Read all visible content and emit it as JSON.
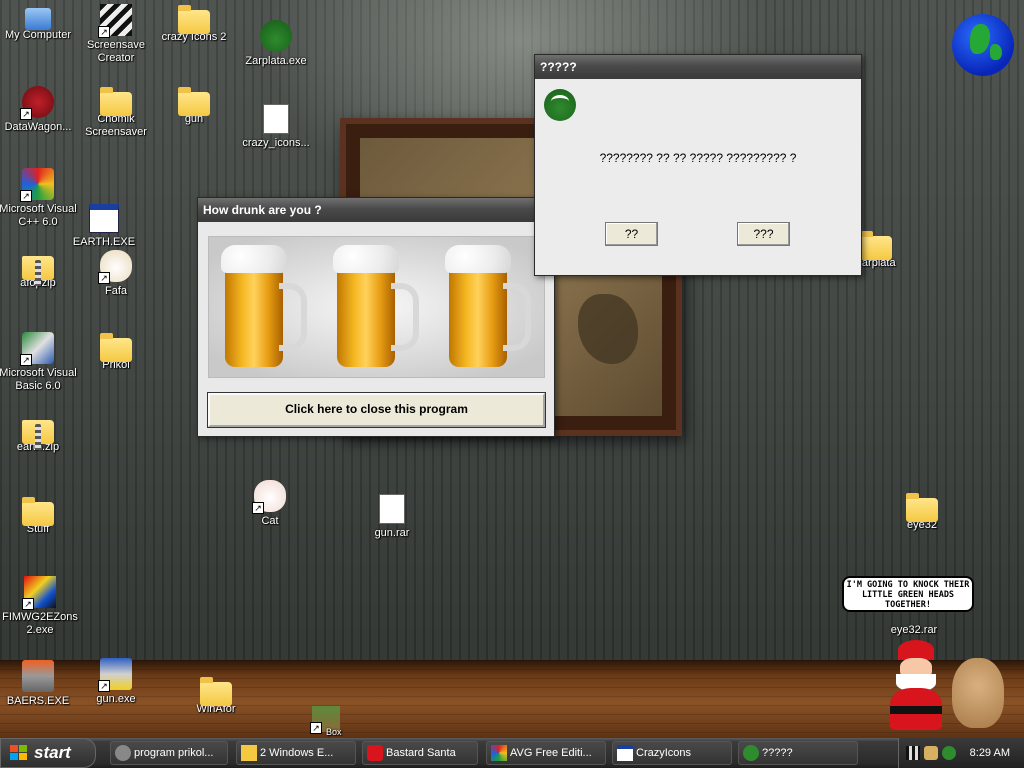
{
  "desktop": {
    "icons": [
      {
        "id": "my-computer",
        "label": "My Computer"
      },
      {
        "id": "screensaver-creator",
        "label": "Screensave\nCreator"
      },
      {
        "id": "crazy-icons-2",
        "label": "crazy Icons 2"
      },
      {
        "id": "zarplata-exe",
        "label": "Zarplata.exe"
      },
      {
        "id": "datawagon",
        "label": "DataWagon..."
      },
      {
        "id": "chomik-screensaver",
        "label": "Chomik\nScreensaver"
      },
      {
        "id": "gun-folder",
        "label": "gun"
      },
      {
        "id": "crazy-icons-file",
        "label": "crazy_icons..."
      },
      {
        "id": "ms-visual-cpp",
        "label": "Microsoft Visual\nC++ 6.0"
      },
      {
        "id": "earth-exe",
        "label": "EARTH.EXE"
      },
      {
        "id": "afopzip",
        "label": "afopzip"
      },
      {
        "id": "fafa",
        "label": "Fafa"
      },
      {
        "id": "ms-visual-basic",
        "label": "Microsoft Visual\nBasic 6.0"
      },
      {
        "id": "prikol",
        "label": "Prikol"
      },
      {
        "id": "earth-zip",
        "label": "earth.zip"
      },
      {
        "id": "cat",
        "label": "Cat"
      },
      {
        "id": "gun-rar",
        "label": "gun.rar"
      },
      {
        "id": "stuff",
        "label": "Stuff"
      },
      {
        "id": "crazy-icons-exe",
        "label": "FIMWG2EZons\n2.exe"
      },
      {
        "id": "zarplata-folder",
        "label": "zarplata"
      },
      {
        "id": "eye32",
        "label": "eye32"
      },
      {
        "id": "eye32-rar",
        "label": "eye32.rar"
      },
      {
        "id": "baers-exe",
        "label": "BAERS.EXE"
      },
      {
        "id": "gun-exe",
        "label": "gun.exe"
      },
      {
        "id": "winafor",
        "label": "WinAfor"
      },
      {
        "id": "box",
        "label": "Box"
      }
    ]
  },
  "drunk_window": {
    "title": "How drunk are you ?",
    "close_label": "Click here to close this program"
  },
  "dialog": {
    "title": "?????",
    "message": "???????? ?? ?? ????? ????????? ?",
    "button_yes": "??",
    "button_no": "???"
  },
  "speech_bubble": "I'M GOING TO KNOCK THEIR LITTLE GREEN HEADS TOGETHER!",
  "taskbar": {
    "start_label": "start",
    "buttons": [
      {
        "label": "program prikol..."
      },
      {
        "label": "2 Windows E..."
      },
      {
        "label": "Bastard Santa"
      },
      {
        "label": "AVG Free Editi..."
      },
      {
        "label": "CrazyIcons"
      },
      {
        "label": "?????"
      }
    ],
    "clock": "8:29 AM"
  },
  "colors": {
    "dialog_logo": "#2e8b2e",
    "folder": "#f5c842",
    "taskbar": "#2a2a2a"
  }
}
